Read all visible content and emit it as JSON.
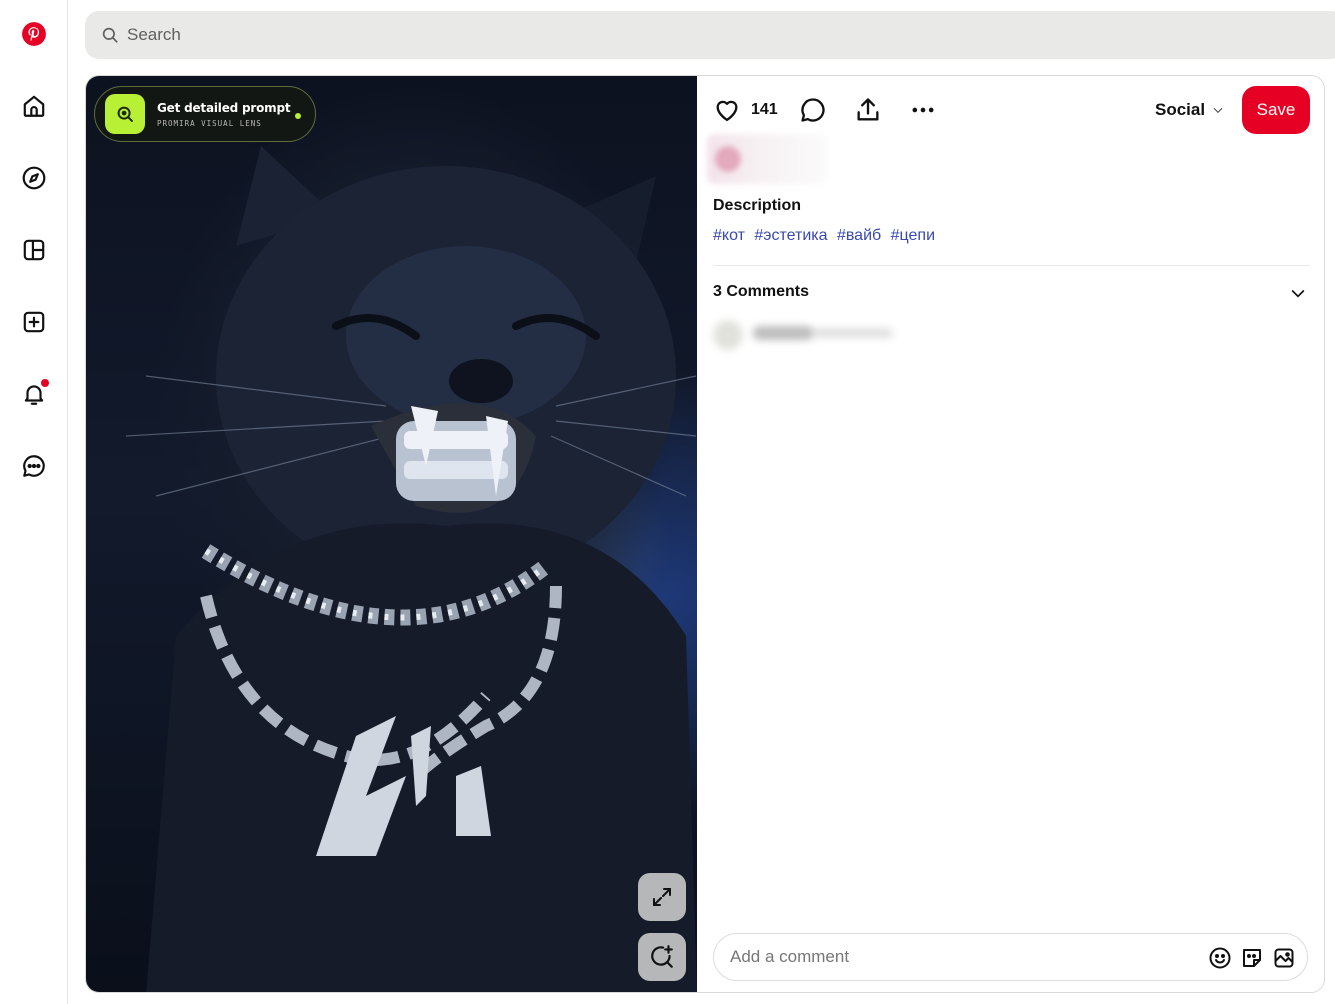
{
  "app": {
    "logo": "pinterest-logo"
  },
  "sidebar": {
    "items": [
      {
        "name": "home",
        "icon": "home-icon"
      },
      {
        "name": "explore",
        "icon": "compass-icon"
      },
      {
        "name": "boards",
        "icon": "layout-icon"
      },
      {
        "name": "create",
        "icon": "plus-square-icon"
      },
      {
        "name": "notifications",
        "icon": "bell-icon",
        "has_badge": true
      },
      {
        "name": "messages",
        "icon": "chat-icon"
      }
    ],
    "badge_color": "#e60023"
  },
  "search": {
    "placeholder": "Search",
    "icon": "search-icon"
  },
  "pin": {
    "lens_badge": {
      "title": "Get detailed prompt",
      "subtitle": "PROMIRA VISUAL LENS",
      "accent": "#b7f035"
    },
    "image_buttons": [
      {
        "name": "expand",
        "icon": "expand-icon"
      },
      {
        "name": "visual-search",
        "icon": "visual-search-icon"
      }
    ],
    "actions": {
      "like_count": "141",
      "board": "Social",
      "save_label": "Save",
      "save_color": "#e60023"
    },
    "description": {
      "title": "Description",
      "hashtags": [
        "#кот",
        "#эстетика",
        "#вайб",
        "#цепи"
      ],
      "hashtag_color": "#3949ab"
    },
    "comments": {
      "title": "3 Comments"
    },
    "comment_box": {
      "placeholder": "Add a comment",
      "icons": [
        "emoji-icon",
        "sticker-icon",
        "image-icon"
      ]
    }
  }
}
